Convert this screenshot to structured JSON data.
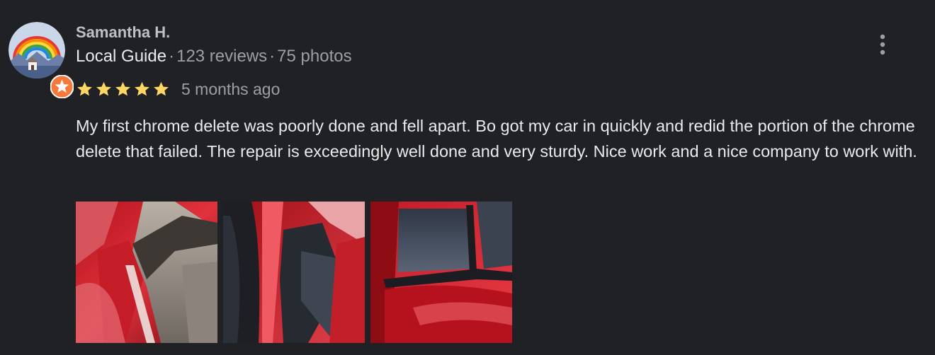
{
  "review": {
    "reviewer": {
      "name": "Samantha H.",
      "badge": "Local Guide",
      "separator": "·",
      "reviews": "123 reviews",
      "photos": "75 photos",
      "avatar_icon": "rainbow-landscape-avatar",
      "badge_icon": "local-guide-star-badge"
    },
    "rating": {
      "stars": 5,
      "max": 5,
      "star_glyph": "★",
      "star_color": "#fdd663"
    },
    "date": "5 months ago",
    "text": "My first chrome delete was poorly done and fell apart. Bo got my car in quickly and redid the portion of the chrome delete that failed. The repair is exceedingly well done and very sturdy. Nice work and a nice company to work with.",
    "more_icon": "more-vert-icon",
    "photos": [
      {
        "subject": "red car side mirror close-up"
      },
      {
        "subject": "red car side mirror black trim"
      },
      {
        "subject": "red car window corner trim"
      }
    ]
  },
  "colors": {
    "background": "#202124",
    "primary_text": "#e8eaed",
    "secondary_text": "#9aa0a6",
    "name_text": "#bdc1c6",
    "star": "#fdd663",
    "badge": "#f5793b"
  }
}
